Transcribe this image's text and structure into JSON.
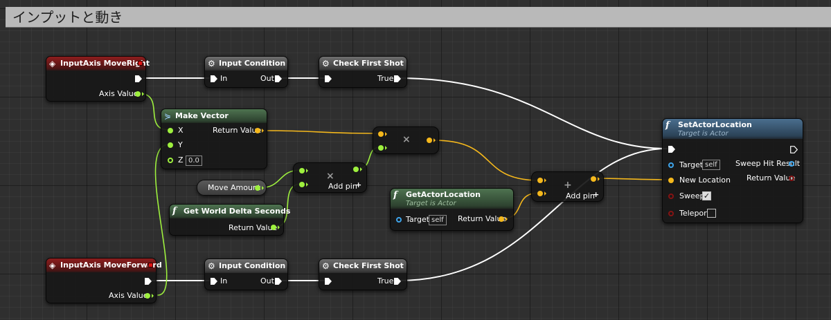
{
  "comment": {
    "title": "インプットと動き"
  },
  "nodes": {
    "input_axis_right": {
      "title": "InputAxis MoveRight",
      "pin_axis_value": "Axis Value"
    },
    "input_cond_1": {
      "title": "Input Condition",
      "pin_in": "In",
      "pin_out": "Out"
    },
    "check_first_1": {
      "title": "Check First Shot",
      "pin_true": "True"
    },
    "make_vector": {
      "title": "Make Vector",
      "pin_x": "X",
      "pin_y": "Y",
      "pin_z": "Z",
      "z_value": "0.0",
      "pin_return": "Return Value"
    },
    "move_amount": {
      "title": "Move Amount"
    },
    "multiply_small": {
      "symbol": "×",
      "add_pin": "Add pin"
    },
    "multiply_top": {
      "symbol": "×"
    },
    "world_delta": {
      "title": "Get World Delta Seconds",
      "pin_return": "Return Value"
    },
    "get_actor_location": {
      "title": "GetActorLocation",
      "subtitle": "Target is Actor",
      "pin_target": "Target",
      "target_value": "self",
      "pin_return": "Return Value"
    },
    "add_node": {
      "symbol": "+",
      "add_pin": "Add pin"
    },
    "set_actor_location": {
      "title": "SetActorLocation",
      "subtitle": "Target is Actor",
      "pin_target": "Target",
      "target_value": "self",
      "pin_new_location": "New Location",
      "pin_sweep": "Sweep",
      "sweep_checked": true,
      "pin_teleport": "Teleport",
      "teleport_checked": false,
      "pin_sweep_hit": "Sweep Hit Result",
      "pin_return": "Return Value"
    },
    "input_axis_forward": {
      "title": "InputAxis MoveForward",
      "pin_axis_value": "Axis Value"
    },
    "input_cond_2": {
      "title": "Input Condition",
      "pin_in": "In",
      "pin_out": "Out"
    },
    "check_first_2": {
      "title": "Check First Shot",
      "pin_true": "True"
    }
  },
  "colors": {
    "exec_wire": "#ffffff",
    "float_wire": "#9ef03e",
    "vector_wire": "#f5b81c",
    "event_header": "#8e1d1d",
    "macro_header": "#6e6e6e",
    "pure_header": "#4e7350",
    "function_header": "#4a6e8e"
  },
  "icons": {
    "event": "diamond-event-icon",
    "macro": "gear-macro-icon",
    "function": "function-f-icon",
    "struct": "make-struct-icon"
  }
}
